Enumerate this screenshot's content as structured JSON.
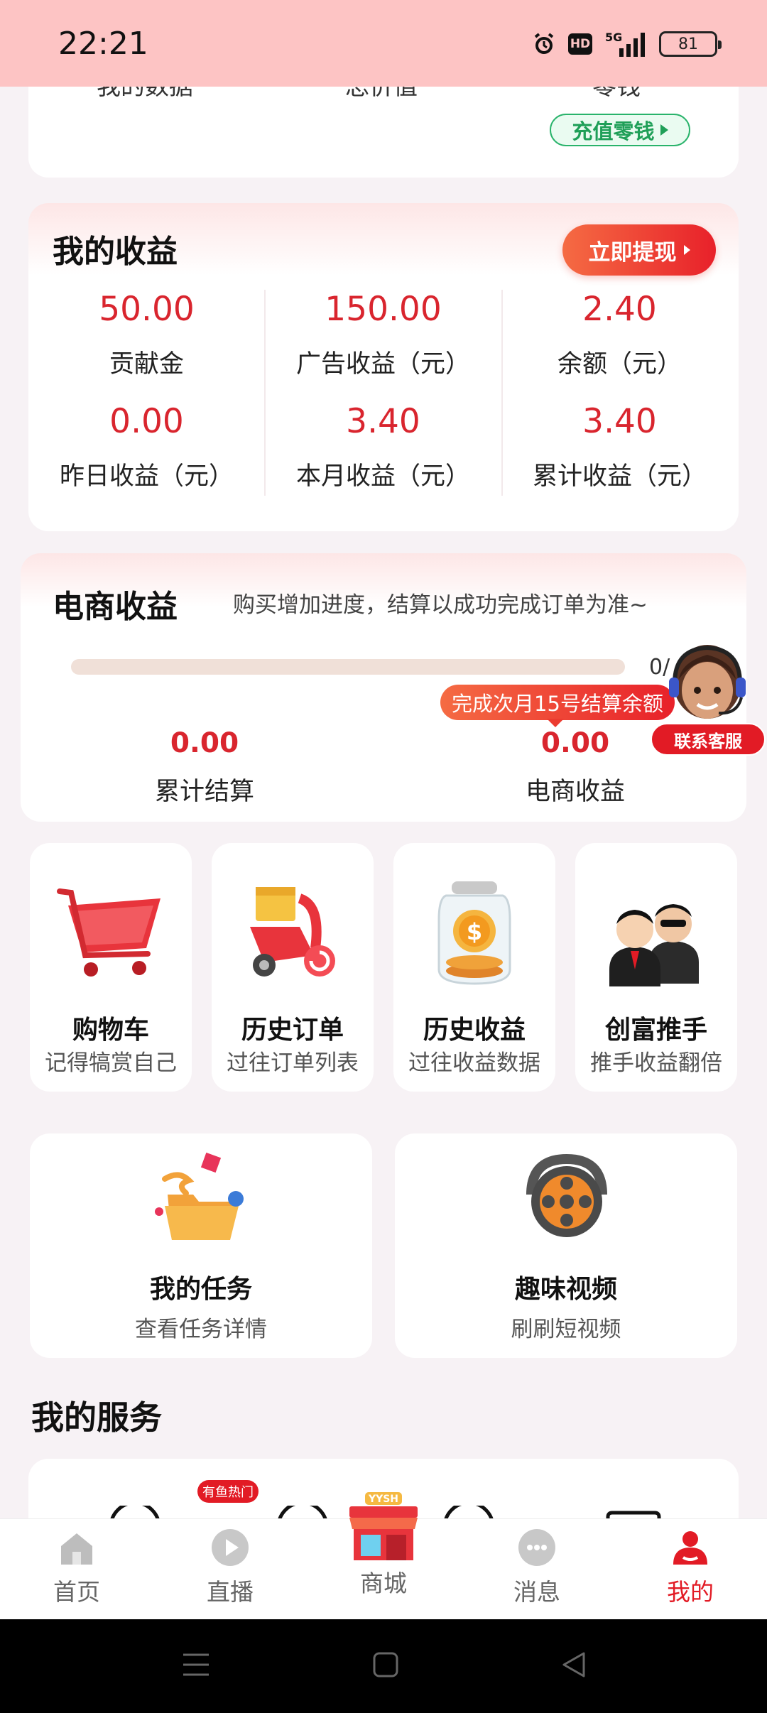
{
  "status_bar": {
    "time": "22:21",
    "network": "5G",
    "hd": "HD",
    "battery": "81"
  },
  "top_card": {
    "labels": [
      "我的数据",
      "总价值",
      "零钱"
    ],
    "recharge_label": "充值零钱"
  },
  "earnings": {
    "title": "我的收益",
    "withdraw_label": "立即提现",
    "stats": [
      {
        "value": "50.00",
        "label": "贡献金"
      },
      {
        "value": "150.00",
        "label": "广告收益（元）"
      },
      {
        "value": "2.40",
        "label": "余额（元）"
      },
      {
        "value": "0.00",
        "label": "昨日收益（元）"
      },
      {
        "value": "3.40",
        "label": "本月收益（元）"
      },
      {
        "value": "3.40",
        "label": "累计收益（元）"
      }
    ]
  },
  "ecommerce": {
    "title": "电商收益",
    "description": "购买增加进度，结算以成功完成订单为准~",
    "progress_fraction": 0,
    "progress_text": "0/",
    "tip": "完成次月15号结算余额",
    "settled_value": "0.00",
    "settled_label": "累计结算",
    "income_value": "0.00",
    "income_label": "电商收益",
    "customer_service": "联系客服"
  },
  "quick_tiles": [
    {
      "title": "购物车",
      "subtitle": "记得犒赏自己",
      "icon": "shopping-cart-icon"
    },
    {
      "title": "历史订单",
      "subtitle": "过往订单列表",
      "icon": "delivery-scooter-icon"
    },
    {
      "title": "历史收益",
      "subtitle": "过往收益数据",
      "icon": "coin-jar-icon"
    },
    {
      "title": "创富推手",
      "subtitle": "推手收益翻倍",
      "icon": "business-people-icon"
    }
  ],
  "feature_tiles": [
    {
      "title": "我的任务",
      "subtitle": "查看任务详情",
      "icon": "task-folder-icon"
    },
    {
      "title": "趣味视频",
      "subtitle": "刷刷短视频",
      "icon": "film-reel-icon"
    }
  ],
  "services": {
    "title": "我的服务",
    "hot_badge": "有鱼热门"
  },
  "tab_bar": {
    "tabs": [
      {
        "label": "首页",
        "icon": "home-icon"
      },
      {
        "label": "直播",
        "icon": "play-icon"
      },
      {
        "label": "商城",
        "icon": "store-icon",
        "store_sign": "YYSH"
      },
      {
        "label": "消息",
        "icon": "chat-bubble-icon"
      },
      {
        "label": "我的",
        "icon": "user-icon"
      }
    ],
    "active": "我的"
  },
  "colors": {
    "accent": "#e21b25",
    "value_red": "#d9252e",
    "status_bar": "#fdc4c4",
    "green": "#1f9f58"
  }
}
